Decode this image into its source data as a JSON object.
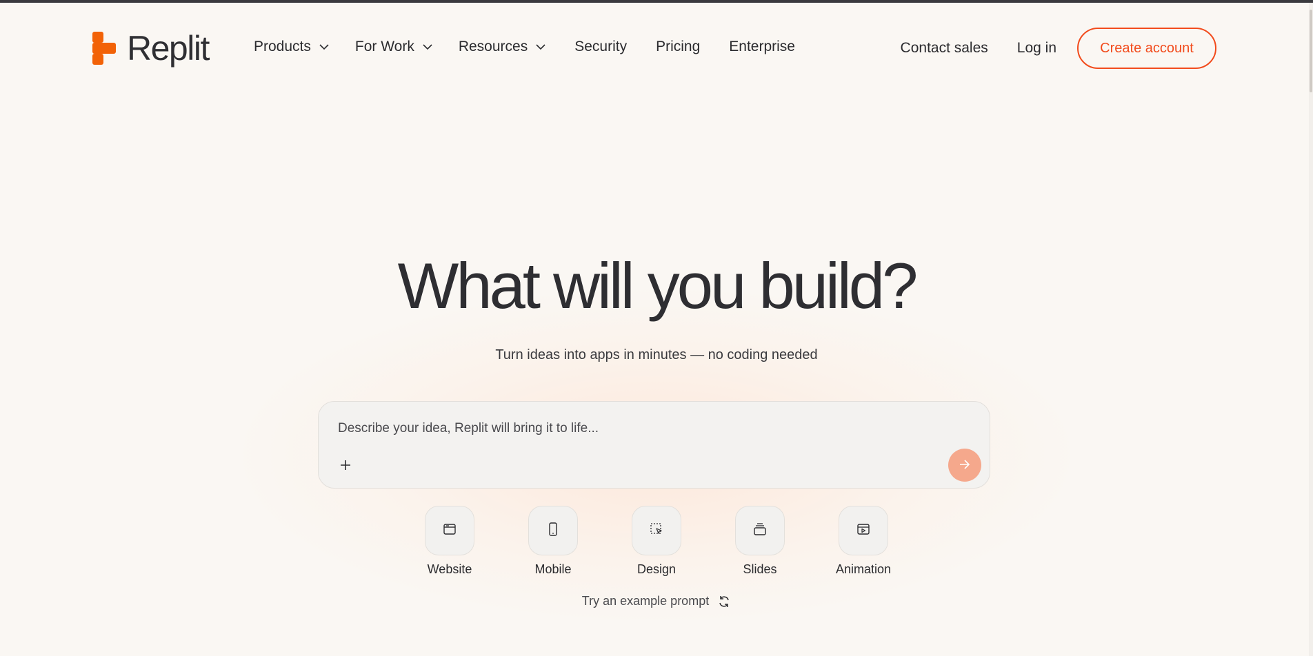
{
  "brand": {
    "name": "Replit",
    "accent": "#f26207",
    "cta_color": "#f24b1c"
  },
  "nav": {
    "items": [
      {
        "label": "Products",
        "has_dropdown": true
      },
      {
        "label": "For Work",
        "has_dropdown": true
      },
      {
        "label": "Resources",
        "has_dropdown": true
      },
      {
        "label": "Security",
        "has_dropdown": false
      },
      {
        "label": "Pricing",
        "has_dropdown": false
      },
      {
        "label": "Enterprise",
        "has_dropdown": false
      }
    ],
    "contact_sales": "Contact sales",
    "login": "Log in",
    "create_account": "Create account"
  },
  "hero": {
    "title": "What will you build?",
    "subtitle": "Turn ideas into apps in minutes — no coding needed"
  },
  "prompt": {
    "placeholder": "Describe your idea, Replit will bring it to life...",
    "value": "",
    "add_icon": "plus-icon",
    "send_icon": "arrow-right-icon",
    "send_color": "#f5a88c"
  },
  "types": [
    {
      "label": "Website",
      "icon": "browser-window-icon"
    },
    {
      "label": "Mobile",
      "icon": "mobile-phone-icon"
    },
    {
      "label": "Design",
      "icon": "selection-cursor-icon"
    },
    {
      "label": "Slides",
      "icon": "stacked-slides-icon"
    },
    {
      "label": "Animation",
      "icon": "play-window-icon"
    }
  ],
  "example_prompt": {
    "label": "Try an example prompt",
    "icon": "refresh-icon"
  }
}
